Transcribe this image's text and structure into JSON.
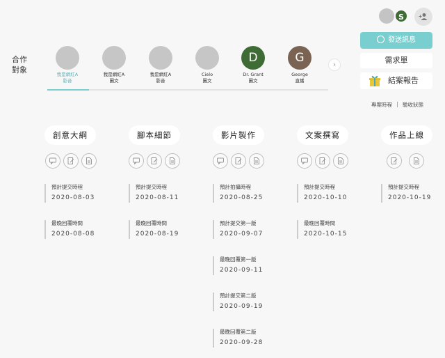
{
  "header": {
    "avatar_initial": "S",
    "send_message_label": "發送訊息",
    "request_label": "需求單",
    "report_label": "結案報告",
    "link_schedule": "專案時程",
    "link_status": "驗收狀態"
  },
  "partners": {
    "label": "合作對象",
    "items": [
      {
        "initial": "",
        "name": "我是網紅A",
        "type": "影音",
        "color": "#c6c6c6"
      },
      {
        "initial": "",
        "name": "我是網紅A",
        "type": "圖文",
        "color": "#c6c6c6"
      },
      {
        "initial": "",
        "name": "我是網紅A",
        "type": "影音",
        "color": "#c6c6c6"
      },
      {
        "initial": "",
        "name": "Cielo",
        "type": "圖文",
        "color": "#c6c6c6"
      },
      {
        "initial": "D",
        "name": "Dr. Grant",
        "type": "圖文",
        "color": "#3f6b35"
      },
      {
        "initial": "G",
        "name": "George",
        "type": "直播",
        "color": "#7a6352"
      }
    ]
  },
  "stages": [
    {
      "title": "創意大綱",
      "entries": [
        {
          "label": "預計提交時程",
          "date": "2020-08-03"
        },
        {
          "label": "最晚回覆時間",
          "date": "2020-08-08"
        }
      ]
    },
    {
      "title": "腳本細節",
      "entries": [
        {
          "label": "預計提交時程",
          "date": "2020-08-11"
        },
        {
          "label": "最晚回覆時間",
          "date": "2020-08-19"
        }
      ]
    },
    {
      "title": "影片製作",
      "entries": [
        {
          "label": "預計拍攝時程",
          "date": "2020-08-25"
        },
        {
          "label": "預計提交第一版",
          "date": "2020-09-07"
        },
        {
          "label": "最晚回覆第一版",
          "date": "2020-09-11"
        },
        {
          "label": "預計提交第二版",
          "date": "2020-09-19"
        },
        {
          "label": "最晚回覆第二版",
          "date": "2020-09-28"
        }
      ]
    },
    {
      "title": "文案撰寫",
      "entries": [
        {
          "label": "預計提交時程",
          "date": "2020-10-10"
        },
        {
          "label": "最晚回覆時間",
          "date": "2020-10-15"
        }
      ]
    },
    {
      "title": "作品上線",
      "entries": [
        {
          "label": "預計提交時程",
          "date": "2020-10-19"
        }
      ]
    }
  ]
}
